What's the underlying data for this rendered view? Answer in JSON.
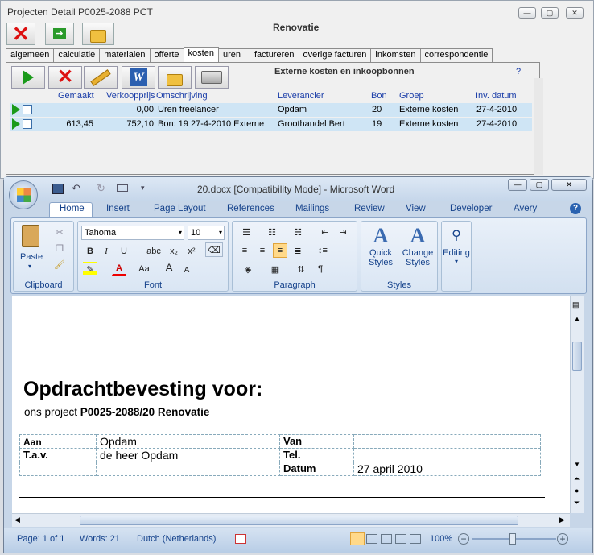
{
  "project_window": {
    "title": "Projecten Detail   P0025-2088   PCT",
    "subtitle": "Renovatie",
    "tabs": [
      "algemeen",
      "calculatie",
      "materialen",
      "offerte",
      "kosten",
      "uren",
      "factureren",
      "overige facturen",
      "inkomsten",
      "correspondentie"
    ],
    "active_tab": "kosten",
    "section_title": "Externe kosten en inkoopbonnen",
    "help": "?",
    "columns": [
      "Gemaakt",
      "Verkoopprijs",
      "Omschrijving",
      "Leverancier",
      "Bon",
      "Groep",
      "Inv. datum"
    ],
    "rows": [
      {
        "gemaakt": "",
        "verkoopprijs": "0,00",
        "omschrijving": "Uren freelancer",
        "leverancier": "Opdam",
        "bon": "20",
        "groep": "Externe kosten",
        "datum": "27-4-2010"
      },
      {
        "gemaakt": "613,45",
        "verkoopprijs": "752,10",
        "omschrijving": "Bon: 19 27-4-2010 Externe l",
        "leverancier": "Groothandel Bert",
        "bon": "19",
        "groep": "Externe kosten",
        "datum": "27-4-2010"
      }
    ]
  },
  "word": {
    "title": "20.docx [Compatibility Mode] - Microsoft Word",
    "tabs": [
      "Home",
      "Insert",
      "Page Layout",
      "References",
      "Mailings",
      "Review",
      "View",
      "Developer",
      "Avery"
    ],
    "active_tab": "Home",
    "font_name": "Tahoma",
    "font_size": "10",
    "groups": {
      "clipboard": "Clipboard",
      "font": "Font",
      "paragraph": "Paragraph",
      "styles": "Styles"
    },
    "paste": "Paste",
    "quick_styles": [
      "Quick",
      "Styles"
    ],
    "change_styles": [
      "Change",
      "Styles"
    ],
    "editing": "Editing",
    "font_buttons": {
      "bold": "B",
      "italic": "I",
      "underline": "U",
      "strike": "abc",
      "sub": "x₂",
      "sup": "x²",
      "grow": "A",
      "shrink": "A",
      "case": "Aa"
    },
    "pilcrow": "¶"
  },
  "document": {
    "heading": "Opdrachtbevesting voor:",
    "sub_prefix": "ons project ",
    "sub_bold": "P0025-2088/20 Renovatie",
    "table": {
      "aan_label": "Aan",
      "aan_value": "Opdam",
      "van_label": "Van",
      "tav_label": "T.a.v.",
      "tav_value": "de heer Opdam",
      "tel_label": "Tel.",
      "datum_label": "Datum",
      "datum_value": "27 april 2010"
    }
  },
  "status": {
    "page": "Page: 1 of 1",
    "words": "Words: 21",
    "language": "Dutch (Netherlands)",
    "zoom": "100%"
  }
}
